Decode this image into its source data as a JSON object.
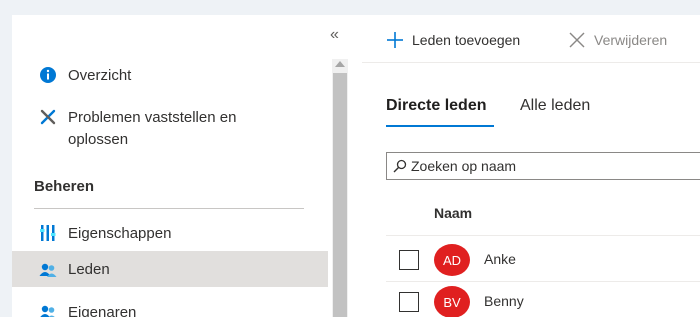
{
  "sidebar": {
    "collapse_glyph": "«",
    "items": [
      {
        "label_lines": [
          "Overzicht"
        ],
        "icon": "info-icon"
      },
      {
        "label_lines": [
          "Problemen vaststellen en",
          "oplossen"
        ],
        "icon": "wrench-screwdriver-icon"
      },
      {
        "label_lines": [
          "Eigenschappen"
        ],
        "icon": "properties-icon"
      },
      {
        "label_lines": [
          "Leden"
        ],
        "icon": "members-icon",
        "selected": true
      },
      {
        "label_lines": [
          "Eigenaren"
        ],
        "icon": "owners-icon"
      }
    ],
    "section_header": "Beheren"
  },
  "toolbar": {
    "add_label": "Leden toevoegen",
    "delete_label": "Verwijderen"
  },
  "tabs": {
    "direct": "Directe leden",
    "all": "Alle leden"
  },
  "search": {
    "placeholder": "Zoeken op naam"
  },
  "table": {
    "header_name": "Naam",
    "rows": [
      {
        "initials": "AD",
        "name": "Anke",
        "avatar_color": "#e02020"
      },
      {
        "initials": "BV",
        "name": "Benny",
        "avatar_color": "#e02020"
      }
    ]
  },
  "colors": {
    "accent": "#0078d4",
    "selected_bg": "#e1dfdd",
    "avatar": "#e02020"
  }
}
